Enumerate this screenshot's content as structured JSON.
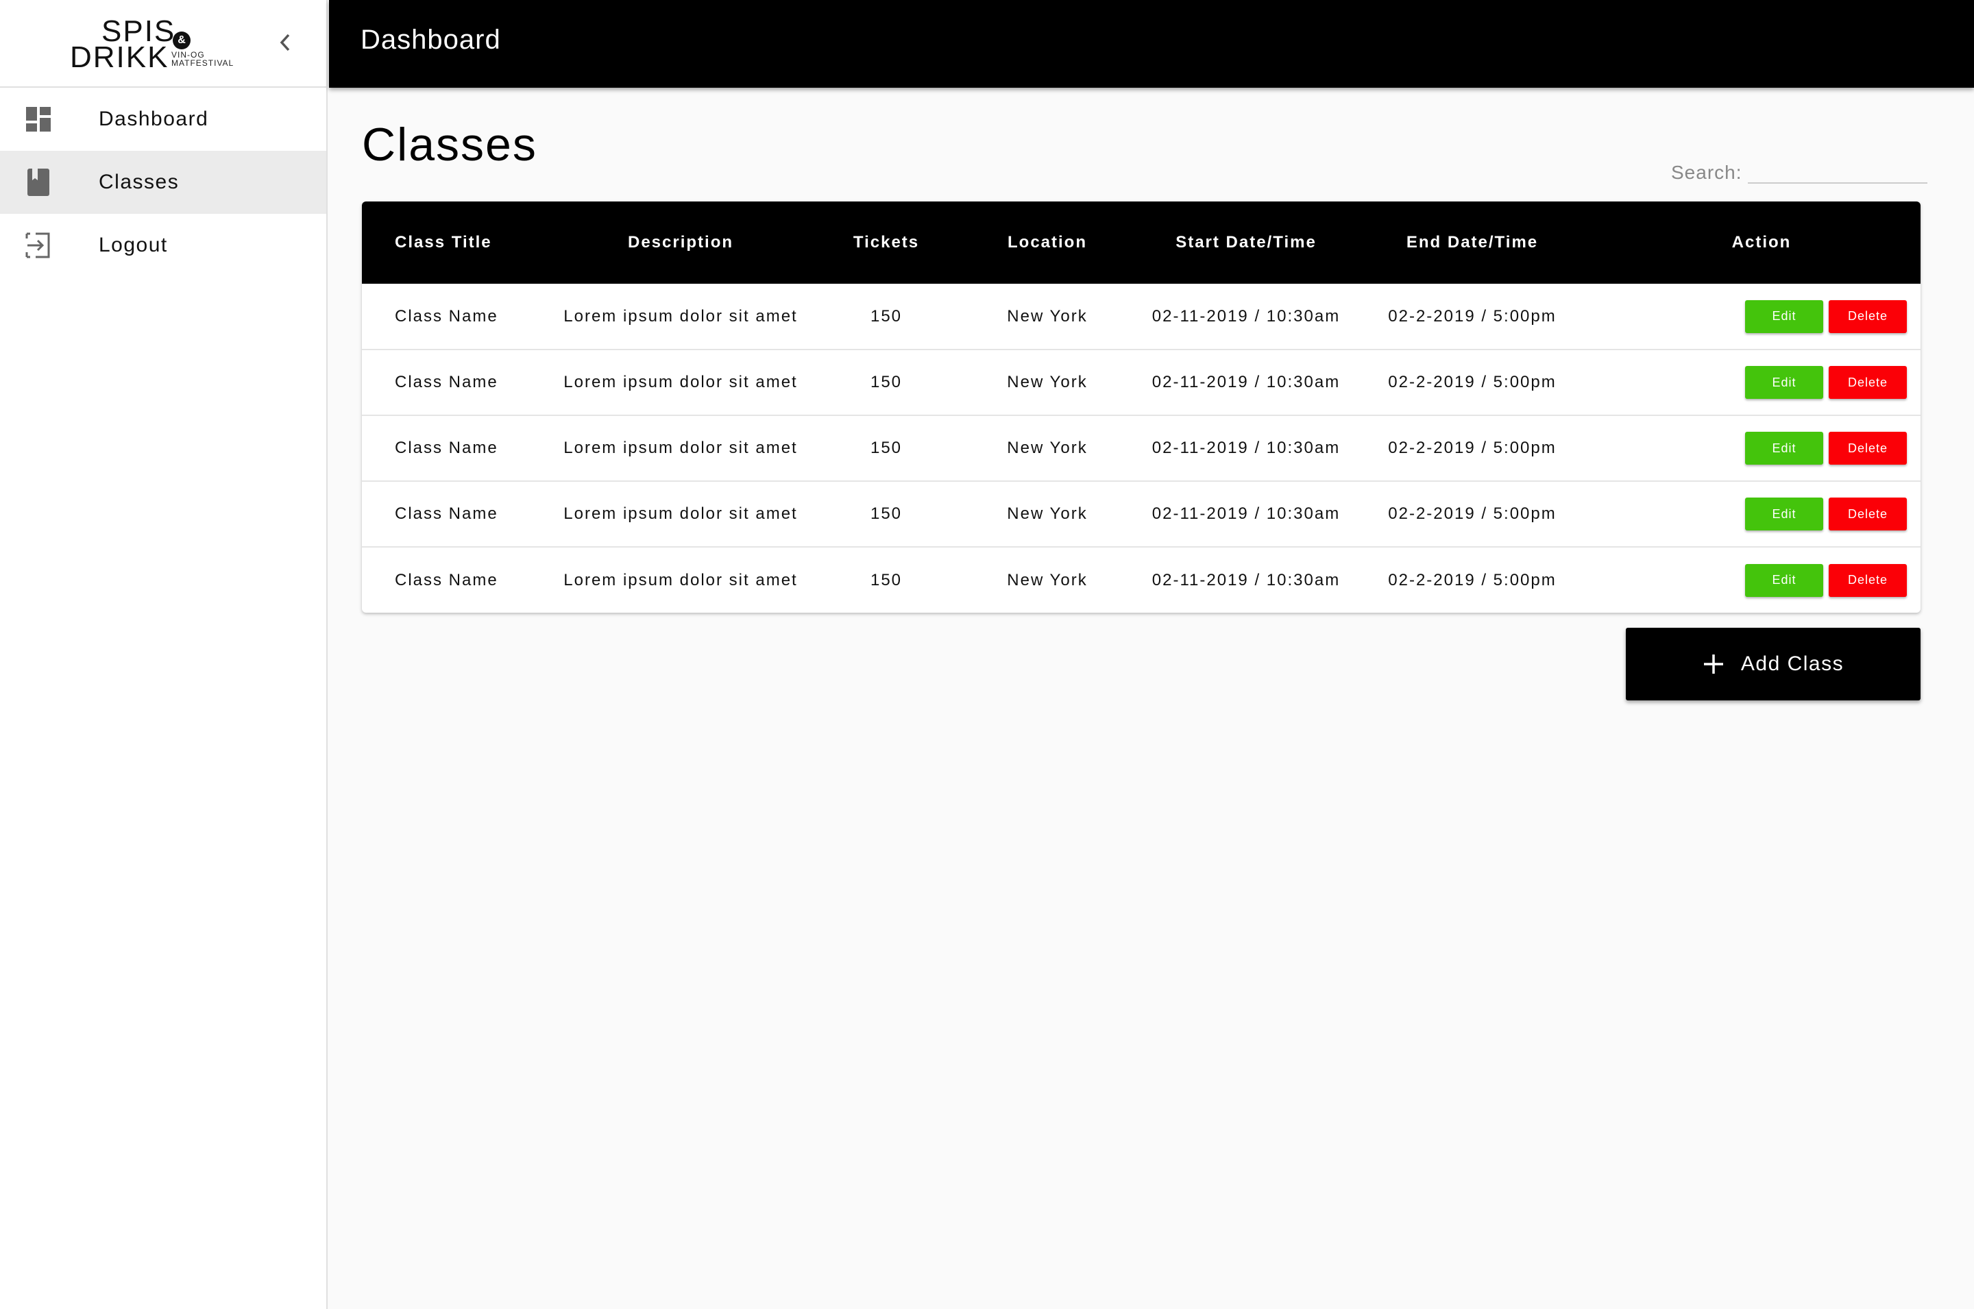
{
  "brand": {
    "logo_top": "SPIS",
    "logo_bottom": "DRIKK",
    "logo_amp": "&",
    "logo_sub1": "VIN-OG",
    "logo_sub2": "MATFESTIVAL"
  },
  "sidebar": {
    "items": [
      {
        "label": "Dashboard",
        "icon": "dashboard-icon",
        "active": false
      },
      {
        "label": "Classes",
        "icon": "book-icon",
        "active": true
      },
      {
        "label": "Logout",
        "icon": "logout-icon",
        "active": false
      }
    ]
  },
  "header": {
    "title": "Dashboard"
  },
  "main": {
    "title": "Classes",
    "search": {
      "label": "Search:",
      "value": "",
      "placeholder": ""
    },
    "table": {
      "columns": [
        "Class Title",
        "Description",
        "Tickets",
        "Location",
        "Start Date/Time",
        "End Date/Time",
        "Action"
      ],
      "rows": [
        [
          "Class Name",
          "Lorem ipsum dolor sit amet",
          "150",
          "New York",
          "02-11-2019 / 10:30am",
          "02-2-2019 / 5:00pm"
        ],
        [
          "Class Name",
          "Lorem ipsum dolor sit amet",
          "150",
          "New York",
          "02-11-2019 / 10:30am",
          "02-2-2019 / 5:00pm"
        ],
        [
          "Class Name",
          "Lorem ipsum dolor sit amet",
          "150",
          "New York",
          "02-11-2019 / 10:30am",
          "02-2-2019 / 5:00pm"
        ],
        [
          "Class Name",
          "Lorem ipsum dolor sit amet",
          "150",
          "New York",
          "02-11-2019 / 10:30am",
          "02-2-2019 / 5:00pm"
        ],
        [
          "Class Name",
          "Lorem ipsum dolor sit amet",
          "150",
          "New York",
          "02-11-2019 / 10:30am",
          "02-2-2019 / 5:00pm"
        ]
      ],
      "edit_label": "Edit",
      "delete_label": "Delete"
    },
    "add_button_label": "Add Class"
  },
  "colors": {
    "header_bg": "#000000",
    "edit": "#44c40c",
    "delete": "#fb0007",
    "active_nav": "#ebebeb"
  }
}
